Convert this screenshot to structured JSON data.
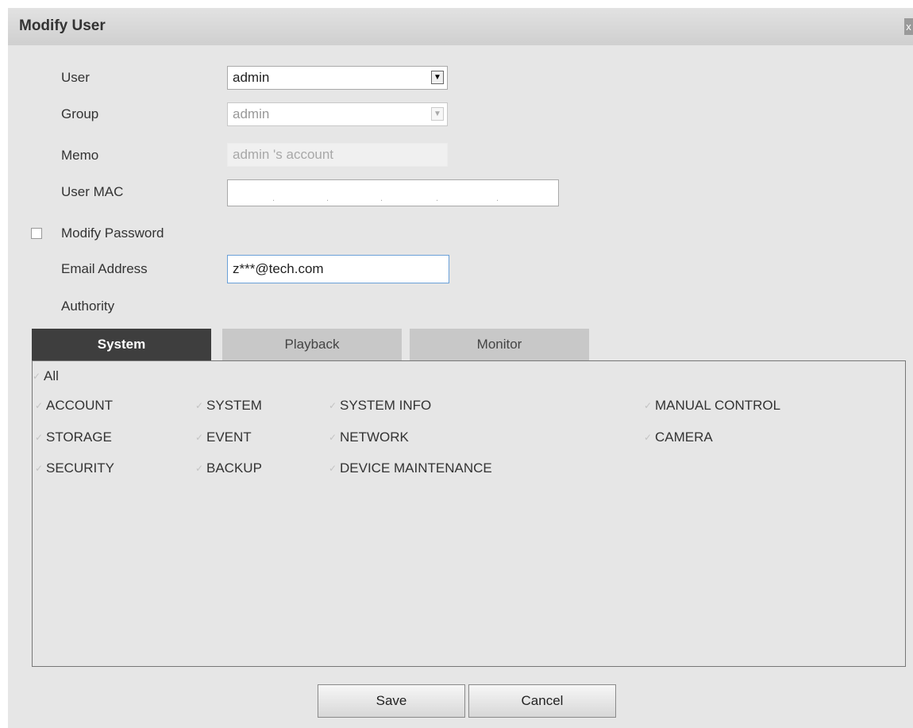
{
  "dialog": {
    "title": "Modify User",
    "close_glyph": "x"
  },
  "form": {
    "user": {
      "label": "User",
      "value": "admin"
    },
    "group": {
      "label": "Group",
      "value": "admin"
    },
    "memo": {
      "label": "Memo",
      "value": "admin 's account"
    },
    "user_mac": {
      "label": "User MAC",
      "separators": [
        ".",
        ".",
        ".",
        ".",
        "."
      ]
    },
    "modify_password": {
      "label": "Modify Password",
      "checked": false
    },
    "email": {
      "label": "Email Address",
      "value": "z***@tech.com"
    },
    "authority": {
      "label": "Authority"
    }
  },
  "tabs": [
    {
      "label": "System",
      "active": true
    },
    {
      "label": "Playback",
      "active": false
    },
    {
      "label": "Monitor",
      "active": false
    }
  ],
  "permissions": {
    "all": "All",
    "items": [
      "ACCOUNT",
      "SYSTEM",
      "SYSTEM INFO",
      "MANUAL CONTROL",
      "STORAGE",
      "EVENT",
      "NETWORK",
      "CAMERA",
      "SECURITY",
      "BACKUP",
      "DEVICE MAINTENANCE"
    ],
    "check_glyph": "✓"
  },
  "buttons": {
    "save": "Save",
    "cancel": "Cancel"
  },
  "icons": {
    "dropdown": "chevron-down-icon",
    "close": "close-icon",
    "check": "check-icon"
  }
}
